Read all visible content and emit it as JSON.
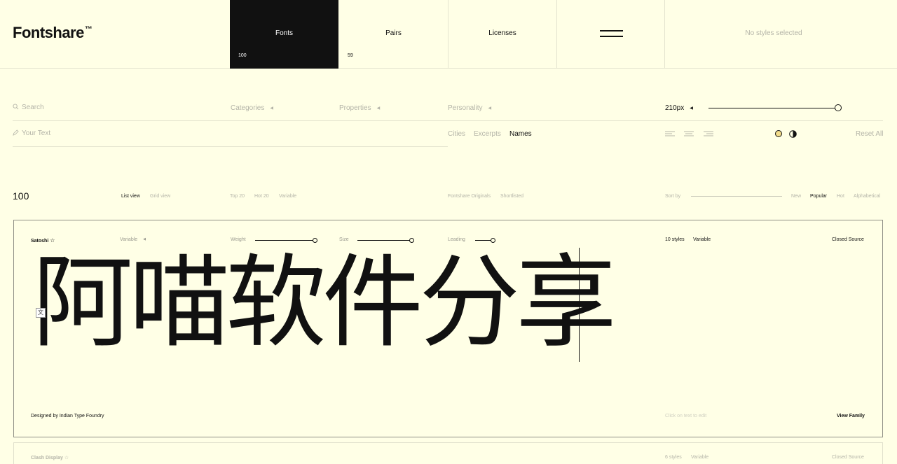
{
  "header": {
    "logo": "Fontshare",
    "logo_mark": "™",
    "nav": [
      {
        "label": "Fonts",
        "count": "100"
      },
      {
        "label": "Pairs",
        "count": "59"
      },
      {
        "label": "Licenses"
      }
    ],
    "styles_status": "No styles selected"
  },
  "filters": {
    "search_placeholder": "Search",
    "categories": "Categories",
    "properties": "Properties",
    "personality": "Personality",
    "size_value": "210px",
    "text_placeholder": "Your Text",
    "sample_tabs": [
      "Cities",
      "Excerpts",
      "Names"
    ],
    "reset": "Reset All"
  },
  "listbar": {
    "count": "100",
    "views": [
      "List view",
      "Grid view"
    ],
    "quick": [
      "Top 20",
      "Hot 20",
      "Variable"
    ],
    "tags": [
      "Fontshare Originals",
      "Shortlisted"
    ],
    "sort_label": "Sort by",
    "sort_options": [
      "New",
      "Popular",
      "Hot",
      "Alphabetical"
    ]
  },
  "card": {
    "font_name": "Satoshi",
    "variant": "Variable",
    "weight_label": "Weight",
    "size_label": "Size",
    "leading_label": "Leading",
    "styles_count": "10 styles",
    "styles_type": "Variable",
    "license": "Closed Source",
    "preview_text": "阿喵软件分享",
    "designer": "Designed by Indian Type Foundry",
    "edit_hint": "Click on text to edit",
    "view_family": "View Family"
  },
  "next_card": {
    "font_name": "Clash Display",
    "styles_count": "6 styles",
    "styles_type": "Variable",
    "license": "Closed Source"
  },
  "colors": {
    "background": "#ffffe6",
    "ink": "#111111",
    "accent_circle": "#f2dc8a"
  }
}
